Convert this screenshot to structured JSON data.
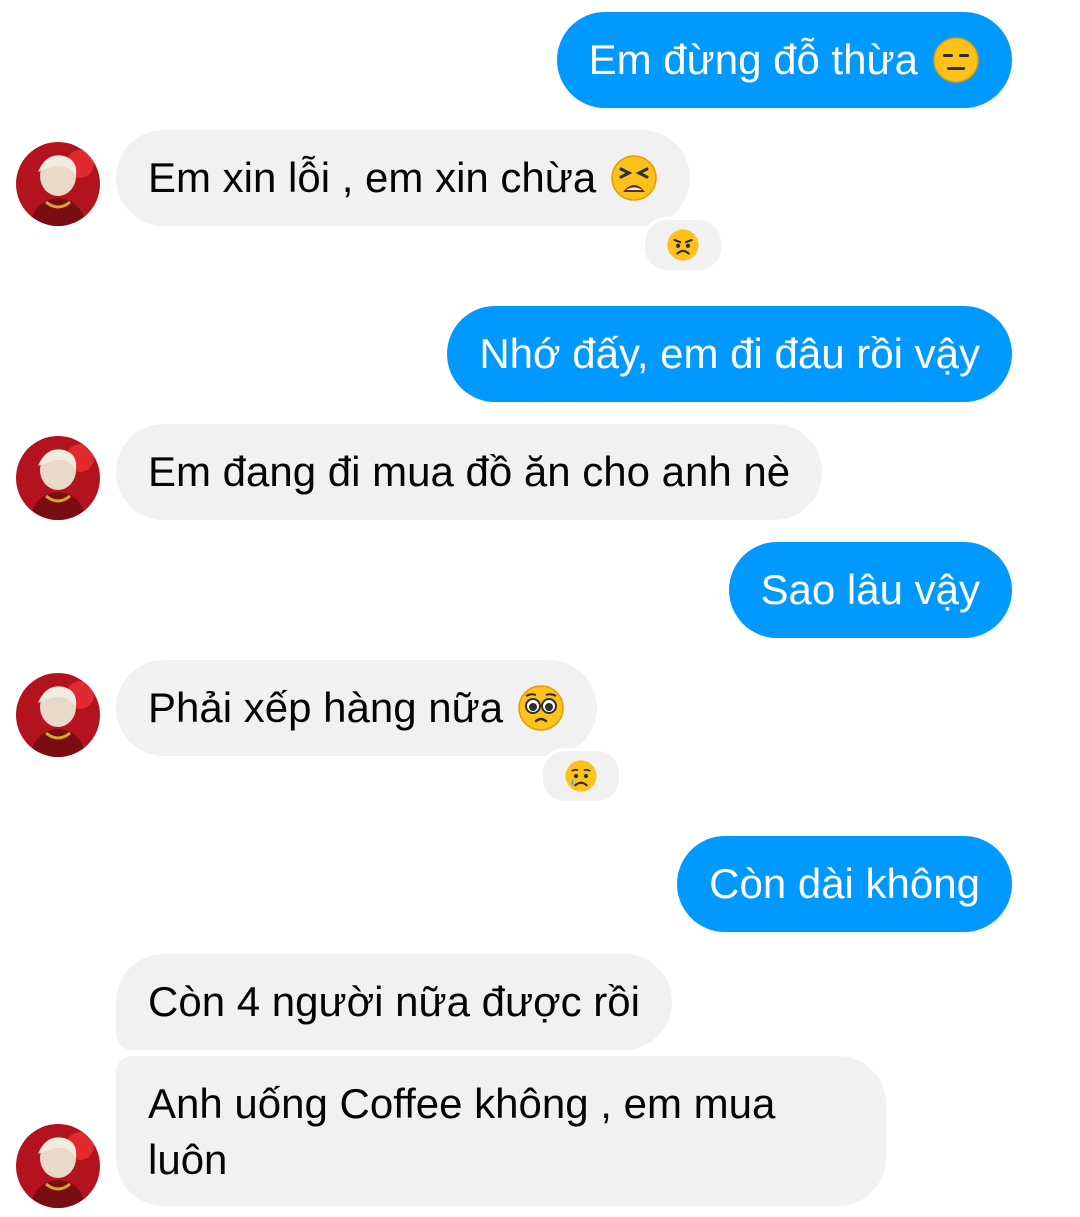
{
  "messages": {
    "m1": {
      "text": "Em đừng đỗ thừa",
      "emoji": "expressionless-face-icon"
    },
    "m2": {
      "text": "Em xin lỗi , em xin chừa",
      "emoji": "tired-face-icon",
      "reaction": "frowning-face-icon"
    },
    "m3": {
      "text": "Nhớ đấy, em đi đâu rồi vậy"
    },
    "m4": {
      "text": "Em đang đi mua đồ ăn cho anh nè"
    },
    "m5": {
      "text": "Sao lâu vậy"
    },
    "m6": {
      "text": "Phải xếp hàng nữa",
      "emoji": "pleading-face-icon",
      "reaction": "crying-face-icon"
    },
    "m7": {
      "text": "Còn dài không"
    },
    "m8": {
      "text": "Còn 4 người nữa được rồi"
    },
    "m9": {
      "text": "Anh uống Coffee không , em mua luôn"
    }
  },
  "colors": {
    "sent_bubble": "#0099ff",
    "received_bubble": "#f1f1f1",
    "sent_text": "#ffffff",
    "received_text": "#050505"
  }
}
